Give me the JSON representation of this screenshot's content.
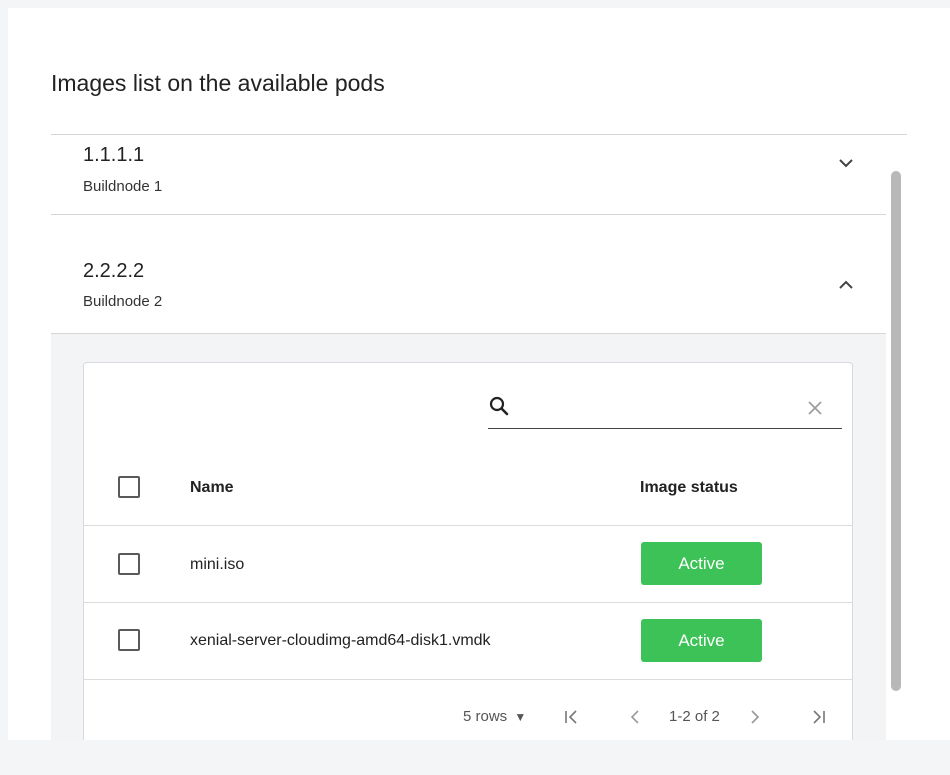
{
  "panel": {
    "title": "Images list on the available pods"
  },
  "accordion": {
    "items": [
      {
        "title": "1.1.1.1",
        "subtitle": "Buildnode 1",
        "expanded": false,
        "icon": "chevron-down-icon"
      },
      {
        "title": "2.2.2.2",
        "subtitle": "Buildnode 2",
        "expanded": true,
        "icon": "chevron-up-icon"
      }
    ]
  },
  "table": {
    "search": {
      "value": "",
      "placeholder": ""
    },
    "columns": {
      "name": "Name",
      "status": "Image status"
    },
    "rows": [
      {
        "name": "mini.iso",
        "status": "Active"
      },
      {
        "name": "xenial-server-cloudimg-amd64-disk1.vmdk",
        "status": "Active"
      }
    ],
    "pagination": {
      "rows_per_page": "5 rows",
      "range": "1-2 of 2"
    }
  },
  "colors": {
    "status_active": "#3cc256",
    "divider": "#d6d6d6",
    "scrollbar": "#b8b8b8"
  }
}
